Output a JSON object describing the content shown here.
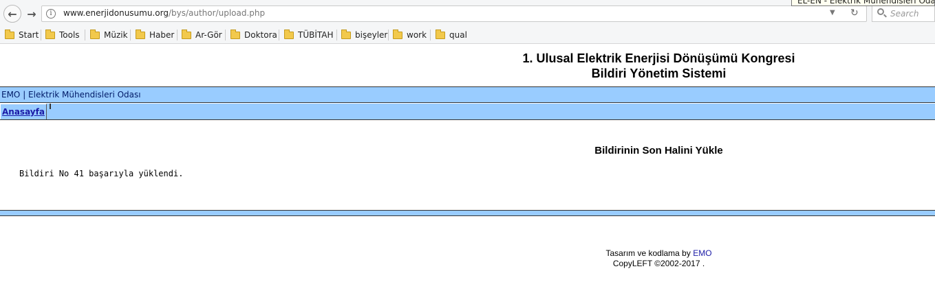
{
  "browser": {
    "url_host": "www.enerjidonusumu.org",
    "url_path": "/bys/author/upload.php",
    "search_placeholder": "Search",
    "tab_tooltip": "EL-EN - Elektrik Mühendisleri Odası|Bi"
  },
  "bookmarks": [
    {
      "label": "Start"
    },
    {
      "label": "Tools"
    },
    {
      "label": "Müzik"
    },
    {
      "label": "Haber"
    },
    {
      "label": "Ar-Gör"
    },
    {
      "label": "Doktora"
    },
    {
      "label": "TÜBİTAH"
    },
    {
      "label": "bişeyler"
    },
    {
      "label": "work"
    },
    {
      "label": "qual"
    }
  ],
  "page": {
    "title_line1": "1. Ulusal Elektrik Enerjisi Dönüşümü Kongresi",
    "title_line2": "Bildiri Yönetim Sistemi",
    "org_link": "EMO | Elektrik Mühendisleri Odası",
    "menu_home": "Anasayfa",
    "section_title": "Bildirinin Son Halini Yükle",
    "result_message": "Bildiri No 41 başarıyla yüklendi.",
    "footer_prefix": "Tasarım ve kodlama by ",
    "footer_link": "EMO",
    "footer_copyleft": "CopyLEFT ©2002-2017 ."
  },
  "colors": {
    "bar_blue": "#99ccff",
    "link_blue": "#1a1aa6"
  }
}
